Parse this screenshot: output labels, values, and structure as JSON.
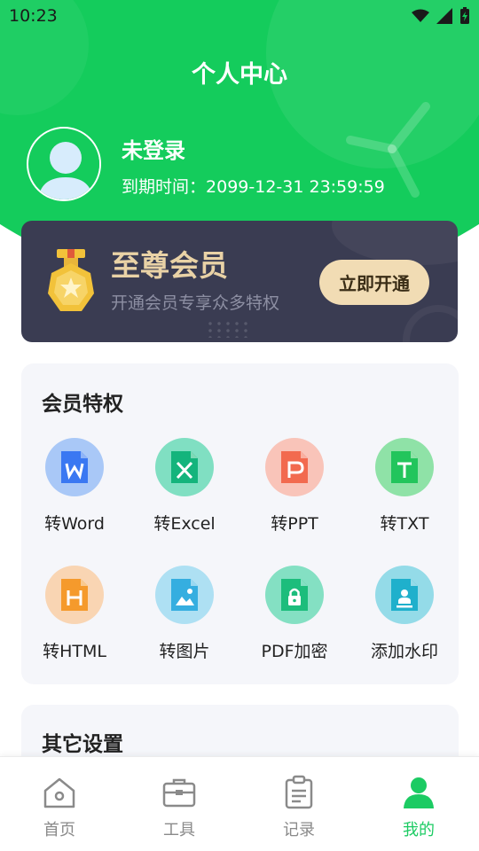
{
  "status": {
    "time": "10:23"
  },
  "header": {
    "title": "个人中心"
  },
  "user": {
    "name": "未登录",
    "expire_label": "到期时间：",
    "expire_value": "2099-12-31 23:59:59"
  },
  "vip": {
    "title": "至尊会员",
    "subtitle": "开通会员专享众多特权",
    "button": "立即开通"
  },
  "privileges": {
    "title": "会员特权",
    "items": [
      {
        "label": "转Word",
        "icon": "word-icon",
        "bg": "#a9c8f7",
        "color": "#3a78f2"
      },
      {
        "label": "转Excel",
        "icon": "excel-icon",
        "bg": "#80dfc2",
        "color": "#14b47c"
      },
      {
        "label": "转PPT",
        "icon": "ppt-icon",
        "bg": "#f9c4b9",
        "color": "#f26a4f"
      },
      {
        "label": "转TXT",
        "icon": "txt-icon",
        "bg": "#8fe2a7",
        "color": "#22c55c"
      },
      {
        "label": "转HTML",
        "icon": "html-icon",
        "bg": "#f9d5b3",
        "color": "#f59a2c"
      },
      {
        "label": "转图片",
        "icon": "image-icon",
        "bg": "#aee0f3",
        "color": "#35aee0"
      },
      {
        "label": "PDF加密",
        "icon": "lock-file-icon",
        "bg": "#84e0c3",
        "color": "#1cbd7c"
      },
      {
        "label": "添加水印",
        "icon": "watermark-icon",
        "bg": "#94dbe8",
        "color": "#1fb0cc"
      }
    ]
  },
  "settings": {
    "title": "其它设置"
  },
  "tabbar": {
    "items": [
      {
        "label": "首页",
        "icon": "home-icon"
      },
      {
        "label": "工具",
        "icon": "toolbox-icon"
      },
      {
        "label": "记录",
        "icon": "clipboard-icon"
      },
      {
        "label": "我的",
        "icon": "user-icon"
      }
    ],
    "active_color": "#1ccb63",
    "inactive_color": "#8a8a8a"
  },
  "colors": {
    "brand": "#14cc5c",
    "vip_card": "#3a3c52",
    "vip_gold": "#e9d2a6"
  }
}
